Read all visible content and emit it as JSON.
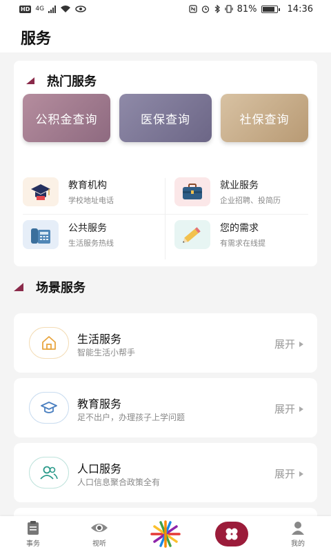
{
  "status_bar": {
    "network": "4G",
    "battery": "81%",
    "time": "14:36"
  },
  "header": {
    "title": "服务"
  },
  "hot_services": {
    "title": "热门服务",
    "query_buttons": [
      {
        "label": "公积金查询"
      },
      {
        "label": "医保查询"
      },
      {
        "label": "社保查询"
      }
    ],
    "items": [
      {
        "title": "教育机构",
        "subtitle": "学校地址电话",
        "icon": "graduation-cap-icon"
      },
      {
        "title": "就业服务",
        "subtitle": "企业招聘、投简历",
        "icon": "briefcase-icon"
      },
      {
        "title": "公共服务",
        "subtitle": "生活服务热线",
        "icon": "telephone-icon"
      },
      {
        "title": "您的需求",
        "subtitle": "有需求在线提",
        "icon": "pencil-icon"
      }
    ]
  },
  "scene_services": {
    "title": "场景服务",
    "cards": [
      {
        "title": "生活服务",
        "subtitle": "智能生活小帮手",
        "action": "展开",
        "icon": "home-icon",
        "color": "#e8a640"
      },
      {
        "title": "教育服务",
        "subtitle": "足不出户，办理孩子上学问题",
        "action": "展开",
        "icon": "graduation-cap-icon",
        "color": "#4a7fc0"
      },
      {
        "title": "人口服务",
        "subtitle": "人口信息聚合政策全有",
        "action": "展开",
        "icon": "people-icon",
        "color": "#2a9a8a"
      }
    ]
  },
  "bottom_nav": {
    "items": [
      {
        "label": "事务",
        "icon": "clipboard-icon"
      },
      {
        "label": "视听",
        "icon": "eye-icon"
      },
      {
        "label": "",
        "icon": "logo-star-icon"
      },
      {
        "label": "",
        "icon": "services-clover-icon"
      },
      {
        "label": "我的",
        "icon": "user-icon"
      }
    ]
  },
  "colors": {
    "accent": "#8a2a4a",
    "background": "#f4f4f4"
  }
}
